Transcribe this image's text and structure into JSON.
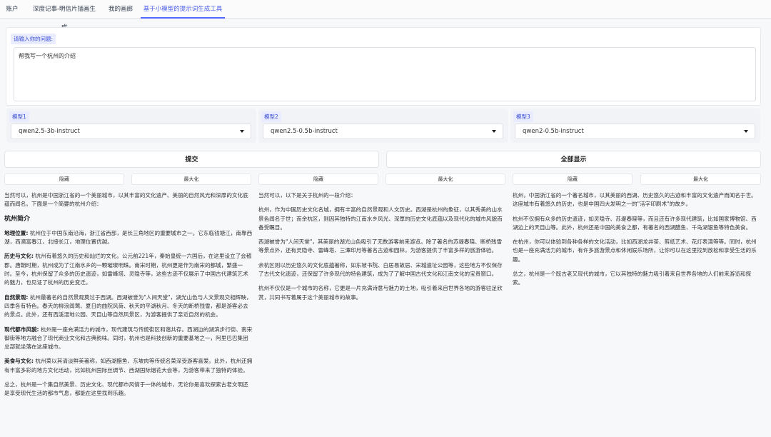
{
  "tabs": [
    {
      "label": "账户"
    },
    {
      "label": "深度记事-明信片插画生成"
    },
    {
      "label": "我的画廊"
    },
    {
      "label": "基于小模型的提示词生成工具"
    }
  ],
  "question": {
    "label": "请输入你的问题:",
    "value": "帮我写一个杭州的介绍"
  },
  "models": [
    {
      "label": "模型1",
      "value": "qwen2.5-3b-instruct"
    },
    {
      "label": "模型2",
      "value": "qwen2.5-0.5b-instruct"
    },
    {
      "label": "模型3",
      "value": "qwen2-0.5b-instruct"
    }
  ],
  "buttons": {
    "submit": "提交",
    "show_all": "全部显示",
    "hide": "隐藏",
    "maximize": "最大化"
  },
  "outputs": {
    "col1": {
      "intro": "当然可以，杭州是中国浙江省的一个美丽城市，以其丰富的文化遗产、美丽的自然风光和深厚的文化底蕴而闻名。下面是一个简要的杭州介绍：",
      "heading": "杭州简介",
      "s1_title": "地理位置:",
      "s1_text": " 杭州位于中国东南沿海，浙江省西部，是长三角地区的重要城市之一。它东临钱塘江，南靠西湖，西濒富春江，北接长江，地理位置优越。",
      "s2_title": "历史与文化:",
      "s2_text": " 杭州有着悠久的历史和灿烂的文化。公元前221年，秦始皇统一六国后，在这里设立了会稽郡。唐朝时期，杭州成为了江南水乡的一颗璀璨明珠。南宋时期，杭州更是作为南宋的都城，繁盛一时。至今，杭州保留了众多的历史遗迹，如雷峰塔、灵隐寺等，这些古迹不仅展示了中国古代建筑艺术的魅力，也见证了杭州的历史变迁。",
      "s3_title": "自然景观:",
      "s3_text": " 杭州最著名的自然景观莫过于西湖。西湖被誉为\"人间天堂\"，湖光山色与人文景观交相辉映，四季各有特色。春天的柳浪闻莺、夏日的曲院风荷、秋天的平湖秋月、冬天的断桥残雪，都是游客必去的景点。此外，还有西溪湿地公园、天目山等自然风景区，为游客提供了亲近自然的机会。",
      "s4_title": "现代都市风貌:",
      "s4_text": " 杭州是一座充满活力的城市，现代建筑与传统街区和谐共存。西湖边的湖滨步行街、南宋御街等地方融合了现代商业文化和古典韵味。同时，杭州也是科技创新的重要基地之一，阿里巴巴集团总部就坐落在这座城市。",
      "s5_title": "美食与文化:",
      "s5_text": " 杭州菜以其清淡鲜美著称，如西湖醋鱼、东坡肉等传统名菜深受游客喜爱。此外，杭州还拥有丰富多彩的地方文化活动，比如杭州国际丝绸节、西湖国际烟花大会等，为游客带来了独特的体验。",
      "summary": "总之，杭州是一个集自然美景、历史文化、现代都市风情于一体的城市，无论你是喜欢探索古老文明还是享受现代生活的都市气息，都能在这里找到乐趣。"
    },
    "col2": {
      "p1": "当然可以，以下是关于杭州的一段介绍：",
      "p2": "杭州，作为中国历史文化名城，拥有丰富的自然景观和人文历史。西湖是杭州的象征，以其秀美的山水景色闻名于世；而余杭区，则因其独特的江南水乡风光、深厚的历史文化底蕴以及现代化的城市风貌而备受瞩目。",
      "p3": "西湖被誉为\"人间天堂\"，其美丽的湖光山色吸引了无数游客前来游览。除了著名的苏堤春晓、断桥残雪等景点外，还有灵隐寺、雷峰塔、三潭印月等著名古迹和园林，为游客提供了丰富多样的旅游体验。",
      "p4": "余杭区则以历史悠久的文化底蕴著称，如东坡书院、白居易故居、宋城遗址公园等，这些地方不仅保存了古代文化遗迹，还保留了许多现代的特色建筑，成为了了解中国古代文化和江南文化的宝贵窗口。",
      "p5": "杭州不仅仅是一个城市的名称，它更是一片充满诗意与魅力的土地，吸引着来自世界各地的游客驻足欣赏，共同书写着属于这个美丽城市的故事。"
    },
    "col3": {
      "p1": "杭州，中国浙江省的一个著名城市，以其美丽的西湖、历史悠久的古迹和丰富的文化遗产而闻名于世。这座城市有着悠久的历史，也是中国四大发明之一的\"活字印刷术\"的故乡。",
      "p2": "杭州不仅拥有众多的历史遗迹，如灵隐寺、苏堤春晓等，而且还有许多现代建筑，比如国家博物馆、西湖边上的天目山等。此外，杭州还是中国的美食之都，有著名的西湖醋鱼、千岛湖银鱼等特色美食。",
      "p3": "在杭州，你可以体验到各种各样的文化活动，比如西湖龙井茶、剪纸艺术、花灯表演等等。同时，杭州也是一座充满活力的城市，有许多旅游景点和休闲娱乐场所，让你可以在这里找到放松和享受生活的乐趣。",
      "p4": "总之，杭州是一个既古老又现代的城市，它以其独特的魅力吸引着来自世界各地的人们前来游览和探索。"
    }
  }
}
